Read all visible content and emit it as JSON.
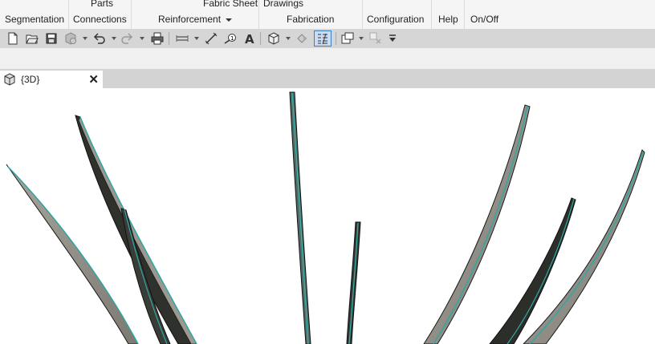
{
  "ribbon": {
    "row1": {
      "parts": "Parts",
      "fabric_sheet": "Fabric Sheet",
      "drawings": "Drawings"
    },
    "row2": {
      "segmentation": "Segmentation",
      "connections": "Connections",
      "reinforcement": "Reinforcement",
      "fabrication": "Fabrication",
      "configuration": "Configuration",
      "help": "Help",
      "onoff": "On/Off"
    }
  },
  "quick_access": {
    "icons": [
      "new-icon",
      "open-icon",
      "save-icon",
      "sync-icon",
      "undo-icon",
      "redo-icon",
      "print-icon",
      "measure-icon",
      "aligned-dimension-icon",
      "tag-icon",
      "text-icon",
      "3d-view-icon",
      "section-icon",
      "thin-lines-icon",
      "switch-windows-icon",
      "close-hidden-icon",
      "customize-icon"
    ]
  },
  "view_tab": {
    "title": "{3D}",
    "close_label": "✕"
  },
  "colors": {
    "accent": "#3c7fc1",
    "ribbon_bg": "#f5f5f5",
    "toolbar_bg": "#d6d6d6",
    "model_edge": "#2fa7a5",
    "model_face": "#8e8b82"
  }
}
